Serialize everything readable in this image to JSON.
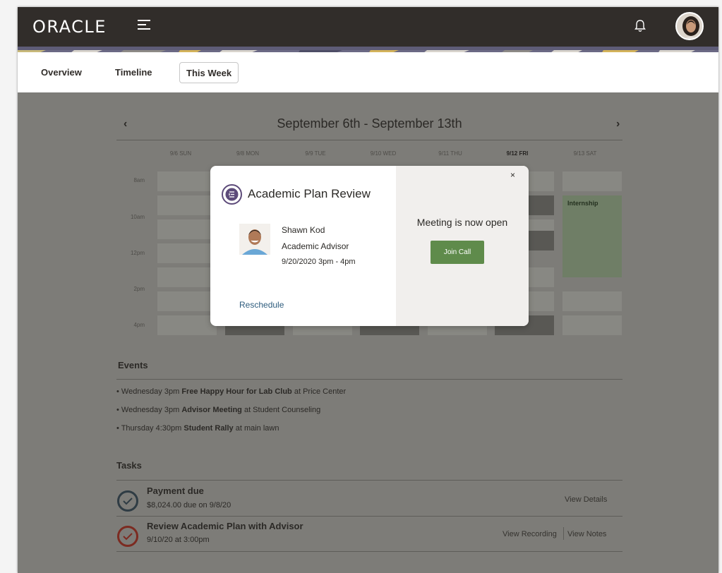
{
  "app": {
    "logo": "ORACLE"
  },
  "header": {
    "icons": [
      "hamburger-menu-icon",
      "bell-icon",
      "user-avatar"
    ]
  },
  "tabs": [
    {
      "label": "Overview",
      "active": false
    },
    {
      "label": "Timeline",
      "active": false
    },
    {
      "label": "This Week",
      "active": true
    }
  ],
  "calendar": {
    "title": "September 6th - September 13th",
    "prev": "‹",
    "next": "›",
    "days": [
      "9/6 SUN",
      "9/8 MON",
      "9/9 TUE",
      "9/10 WED",
      "9/11 THU",
      "9/12 FRI",
      "9/13 SAT"
    ],
    "current_day": "9/12 FRI",
    "times": [
      "8am",
      "10am",
      "12pm",
      "2pm",
      "4pm"
    ],
    "event_label": "Internship"
  },
  "events": {
    "title": "Events",
    "items": [
      {
        "prefix": "• Wednesday 3pm ",
        "name": "Free Happy Hour for Lab Club",
        "suffix": " at Price Center"
      },
      {
        "prefix": "• Wednesday 3pm ",
        "name": "Advisor Meeting",
        "suffix": " at Student Counseling"
      },
      {
        "prefix": "• Thursday 4:30pm ",
        "name": "Student Rally",
        "suffix": " at main lawn"
      }
    ]
  },
  "tasks": {
    "title": "Tasks",
    "items": [
      {
        "title": "Payment due",
        "sub": "$8,024.00 due on 9/8/20",
        "links": [
          "View Details"
        ]
      },
      {
        "title": "Review Academic Plan with Advisor",
        "sub": "9/10/20 at 3:00pm",
        "links": [
          "View Recording",
          "View Notes"
        ]
      }
    ]
  },
  "modal": {
    "title": "Academic Plan Review",
    "person_name": "Shawn Kod",
    "person_role": "Academic Advisor",
    "datetime": "9/20/2020  3pm - 4pm",
    "reschedule": "Reschedule",
    "status": "Meeting is now open",
    "join_label": "Join Call",
    "close": "×"
  },
  "colors": {
    "header_bg": "#312d2a",
    "join_button": "#5f8b4b",
    "link": "#2e5c7d",
    "event_green": "#6f7e66"
  }
}
